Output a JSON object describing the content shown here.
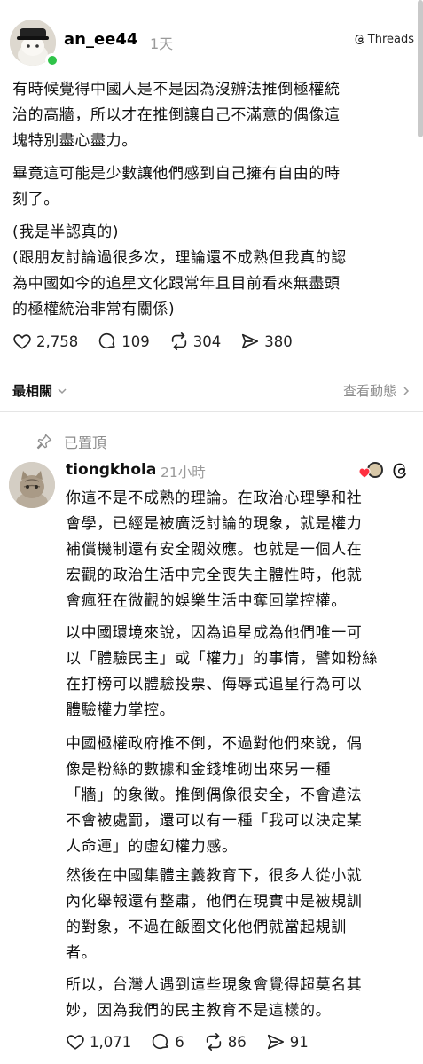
{
  "post": {
    "username": "an_ee44",
    "time": "1天",
    "app_badge": "Threads",
    "paragraphs": [
      [
        "有時候覺得中國人是不是因為沒辦法推倒極權統",
        "治的高牆，所以才在推倒讓自己不滿意的偶像這",
        "塊特別盡心盡力。"
      ],
      [
        "畢竟這可能是少數讓他們感到自己擁有自由的時",
        "刻了。"
      ],
      [
        "(我是半認真的)",
        "(跟朋友討論過很多次，理論還不成熟但我真的認",
        "為中國如今的追星文化跟常年且目前看來無盡頭",
        "的極權統治非常有關係)"
      ]
    ],
    "stats": {
      "likes": "2,758",
      "comments": "109",
      "reposts": "304",
      "shares": "380"
    }
  },
  "sort": {
    "label": "最相關",
    "view_activity": "查看動態"
  },
  "pinned_label": "已置頂",
  "reply": {
    "username": "tiongkhola",
    "time": "21小時",
    "paragraphs": [
      [
        "你這不是不成熟的理論。在政治心理學和社",
        "會學，已經是被廣泛討論的現象，就是權力",
        "補償機制還有安全閥效應。也就是一個人在",
        "宏觀的政治生活中完全喪失主體性時，他就",
        "會瘋狂在微觀的娛樂生活中奪回掌控權。"
      ],
      [
        "以中國環境來說，因為追星成為他們唯一可",
        "以「體驗民主」或「權力」的事情，譬如粉絲",
        "在打榜可以體驗投票、侮辱式追星行為可以",
        "體驗權力掌控。"
      ],
      [
        "中國極權政府推不倒，不過對他們來說，偶",
        "像是粉絲的數據和金錢堆砌出來另一種",
        "「牆」的象徵。推倒偶像很安全，不會違法",
        "不會被處罰，還可以有一種「我可以決定某",
        "人命運」的虛幻權力感。"
      ],
      [
        "然後在中國集體主義教育下，很多人從小就",
        "內化舉報還有整肅，他們在現實中是被規訓",
        "的對象，不過在飯圈文化他們就當起規訓",
        "者。"
      ],
      [
        "所以，台灣人遇到這些現象會覺得超莫名其",
        "妙，因為我們的民主教育不是這樣的。"
      ]
    ],
    "stats": {
      "likes": "1,071",
      "comments": "6",
      "reposts": "86",
      "shares": "91"
    }
  },
  "icons": {
    "threads": "threads-logo-icon",
    "like": "heart-icon",
    "comment": "comment-bubble-icon",
    "repost": "repost-icon",
    "share": "send-icon",
    "chevron": "chevron-right-icon",
    "pin": "pin-icon"
  },
  "colors": {
    "online": "#2fc349",
    "muted": "#8e8e8e",
    "like_red": "#ff3040"
  }
}
